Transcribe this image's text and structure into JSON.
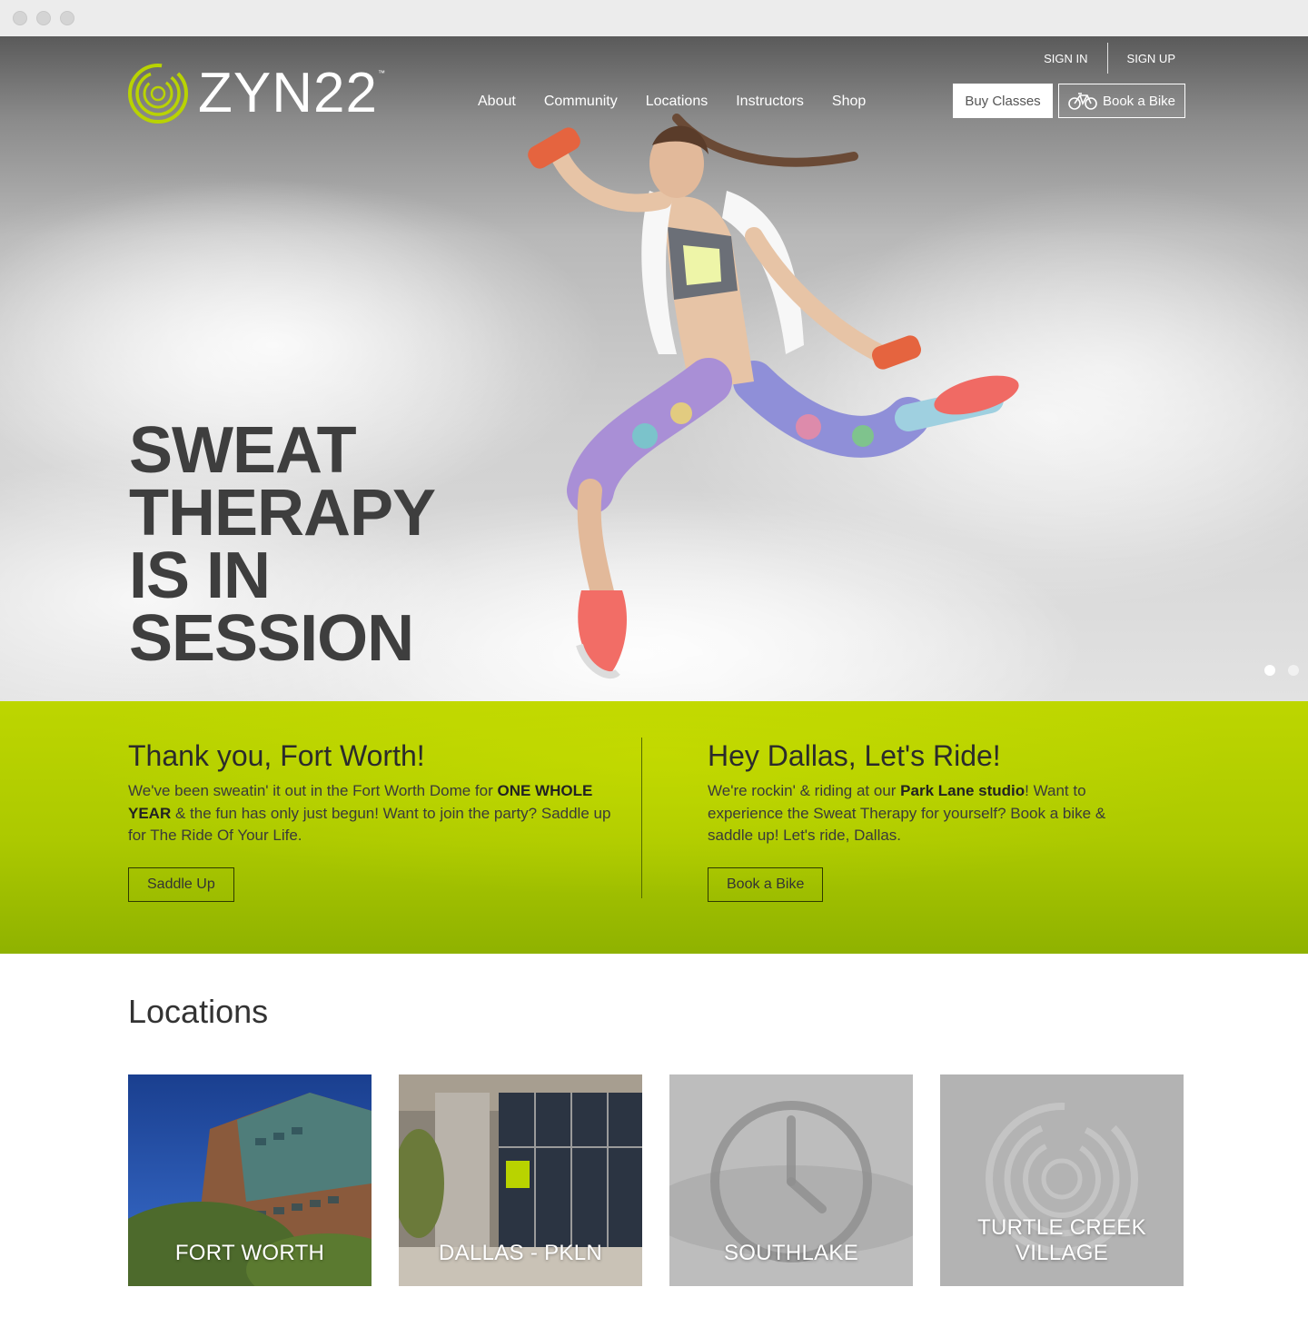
{
  "brand": {
    "name": "ZYN22",
    "trademark": "™",
    "accent_color": "#b9d300",
    "logo_icon": "zyn22-ring-logo"
  },
  "auth": {
    "sign_in": "SIGN IN",
    "sign_up": "SIGN UP"
  },
  "nav": {
    "items": [
      "About",
      "Community",
      "Locations",
      "Instructors",
      "Shop"
    ]
  },
  "actions": {
    "buy_classes": "Buy Classes",
    "book_bike": "Book a Bike",
    "book_bike_icon": "bicycle-icon"
  },
  "hero": {
    "headline": [
      "SWEAT",
      "THERAPY",
      "IS IN",
      "SESSION"
    ],
    "slides_total": 2,
    "active_slide": 1
  },
  "promo": {
    "left": {
      "title": "Thank you, Fort Worth!",
      "text_1": "We've been sweatin' it out in the Fort Worth Dome for ",
      "bold_1": "ONE WHOLE YEAR",
      "text_2": " & the fun has only just begun! Want to join the party? Saddle up for The Ride Of Your Life.",
      "button": "Saddle Up"
    },
    "right": {
      "title": "Hey Dallas, Let's Ride!",
      "text_1": "We're rockin' & riding at our ",
      "bold_1": "Park Lane studio",
      "text_2": "! Want to experience the Sweat Therapy for yourself? Book a bike & saddle up! Let's ride, Dallas.",
      "button": "Book a Bike"
    }
  },
  "locations": {
    "title": "Locations",
    "items": [
      {
        "name": "FORT WORTH"
      },
      {
        "name": "DALLAS - PKLN"
      },
      {
        "name": "SOUTHLAKE",
        "icon": "clock-icon"
      },
      {
        "name": "TURTLE CREEK VILLAGE",
        "icon": "zyn22-ring-icon"
      }
    ]
  }
}
